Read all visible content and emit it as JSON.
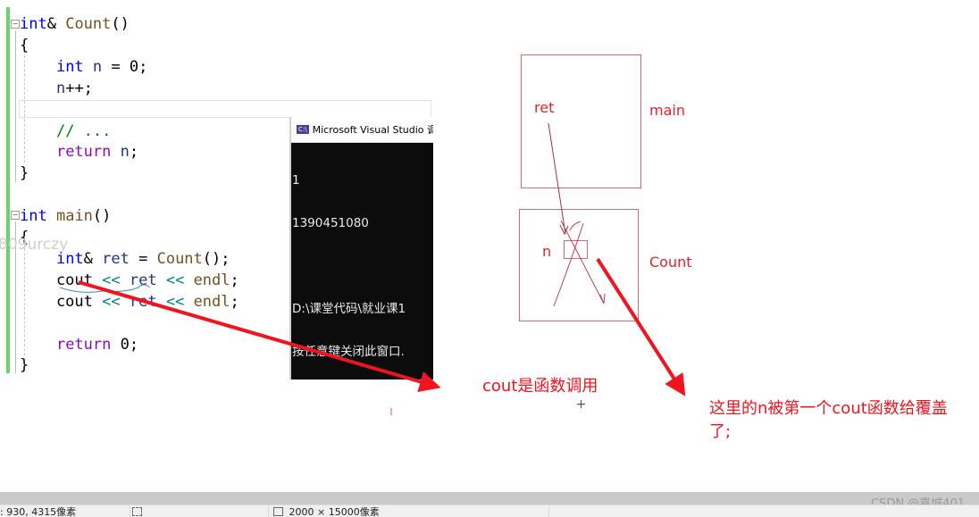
{
  "editor": {
    "lines": [
      {
        "tokens": [
          {
            "t": "int",
            "c": "kw"
          },
          {
            "t": "& ",
            "c": ""
          },
          {
            "t": "Count",
            "c": "fn"
          },
          {
            "t": "()",
            "c": ""
          }
        ]
      },
      {
        "tokens": [
          {
            "t": "{",
            "c": ""
          }
        ]
      },
      {
        "tokens": [
          {
            "t": "    ",
            "c": ""
          },
          {
            "t": "int",
            "c": "kw"
          },
          {
            "t": " ",
            "c": ""
          },
          {
            "t": "n",
            "c": "var"
          },
          {
            "t": " = 0;",
            "c": ""
          }
        ]
      },
      {
        "tokens": [
          {
            "t": "    ",
            "c": ""
          },
          {
            "t": "n",
            "c": "var"
          },
          {
            "t": "++;",
            "c": ""
          }
        ]
      },
      {
        "tokens": [
          {
            "t": "",
            "c": ""
          }
        ]
      },
      {
        "tokens": [
          {
            "t": "    ",
            "c": ""
          },
          {
            "t": "// ...",
            "c": "cmt"
          }
        ]
      },
      {
        "tokens": [
          {
            "t": "    ",
            "c": ""
          },
          {
            "t": "return",
            "c": "kw2"
          },
          {
            "t": " ",
            "c": ""
          },
          {
            "t": "n",
            "c": "var"
          },
          {
            "t": ";",
            "c": ""
          }
        ]
      },
      {
        "tokens": [
          {
            "t": "}",
            "c": ""
          }
        ]
      },
      {
        "tokens": [
          {
            "t": "",
            "c": ""
          }
        ]
      },
      {
        "tokens": [
          {
            "t": "int",
            "c": "kw"
          },
          {
            "t": " ",
            "c": ""
          },
          {
            "t": "main",
            "c": "fn"
          },
          {
            "t": "()",
            "c": ""
          }
        ]
      },
      {
        "tokens": [
          {
            "t": "{",
            "c": ""
          }
        ]
      },
      {
        "tokens": [
          {
            "t": "    ",
            "c": ""
          },
          {
            "t": "int",
            "c": "kw"
          },
          {
            "t": "& ",
            "c": ""
          },
          {
            "t": "ret",
            "c": "var"
          },
          {
            "t": " = ",
            "c": ""
          },
          {
            "t": "Count",
            "c": "fn"
          },
          {
            "t": "();",
            "c": ""
          }
        ]
      },
      {
        "tokens": [
          {
            "t": "    cout ",
            "c": ""
          },
          {
            "t": "<<",
            "c": "op"
          },
          {
            "t": " ",
            "c": ""
          },
          {
            "t": "ret",
            "c": "var"
          },
          {
            "t": " ",
            "c": ""
          },
          {
            "t": "<<",
            "c": "op"
          },
          {
            "t": " ",
            "c": ""
          },
          {
            "t": "endl",
            "c": "fn"
          },
          {
            "t": ";",
            "c": ""
          }
        ]
      },
      {
        "tokens": [
          {
            "t": "    cout ",
            "c": ""
          },
          {
            "t": "<<",
            "c": "op"
          },
          {
            "t": " ",
            "c": ""
          },
          {
            "t": "ret",
            "c": "var"
          },
          {
            "t": " ",
            "c": ""
          },
          {
            "t": "<<",
            "c": "op"
          },
          {
            "t": " ",
            "c": ""
          },
          {
            "t": "endl",
            "c": "fn"
          },
          {
            "t": ";",
            "c": ""
          }
        ]
      },
      {
        "tokens": [
          {
            "t": "",
            "c": ""
          }
        ]
      },
      {
        "tokens": [
          {
            "t": "    ",
            "c": ""
          },
          {
            "t": "return",
            "c": "kw2"
          },
          {
            "t": " 0;",
            "c": ""
          }
        ]
      },
      {
        "tokens": [
          {
            "t": "}",
            "c": ""
          }
        ]
      }
    ],
    "side_watermark": "809urczy"
  },
  "console": {
    "icon": "console-app-icon",
    "title": "Microsoft Visual Studio 调",
    "output_lines": [
      "1",
      "1390451080",
      "",
      "D:\\课堂代码\\就业课1",
      "按任意键关闭此窗口."
    ]
  },
  "diagram": {
    "main_box_label": "main",
    "main_var_label": "ret",
    "count_box_label": "Count",
    "count_var_label": "n",
    "annotation_cout": "cout是函数调用",
    "annotation_overwrite_line1": "这里的n被第一个cout函数给覆盖",
    "annotation_overwrite_line2": "了;",
    "accent_color": "#f0141e"
  },
  "statusbar": {
    "cursor_position": ": 930, 4315像素",
    "selection_size": "",
    "image_size": "2000 × 15000像素"
  },
  "watermark": "CSDN @嘉城401"
}
